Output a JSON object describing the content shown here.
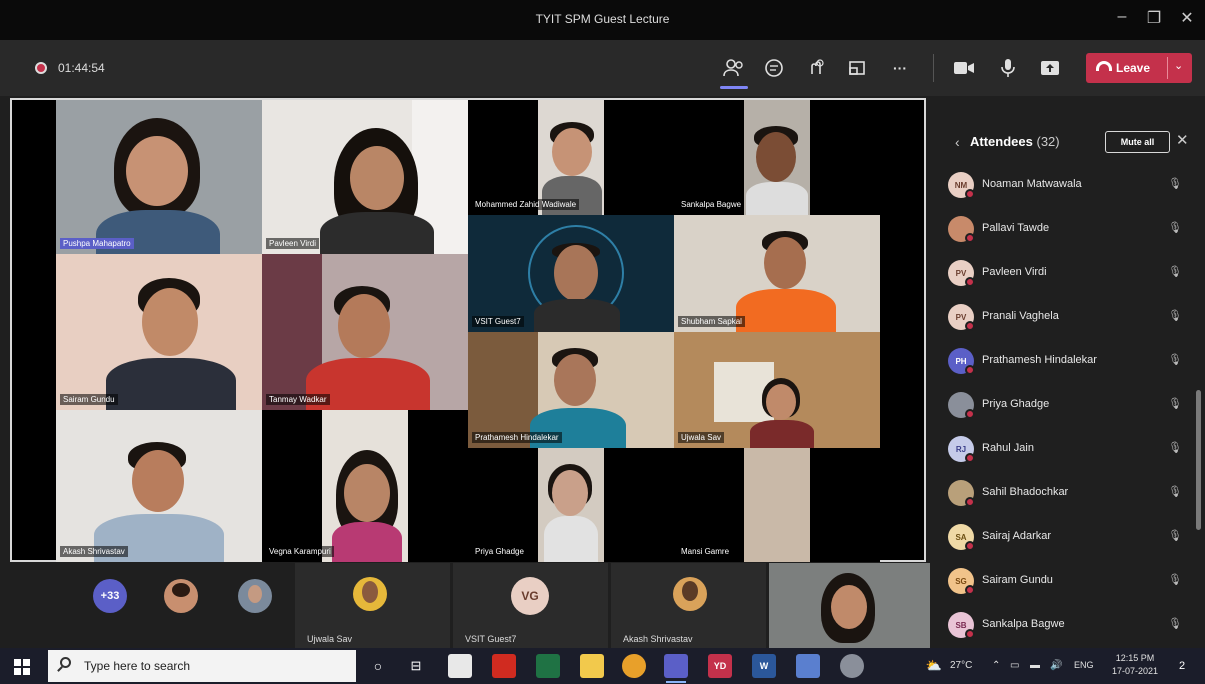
{
  "window": {
    "title": "TYIT SPM Guest Lecture",
    "minimize": "–",
    "maximize": "❐",
    "close": "✕"
  },
  "toolbar": {
    "timer": "01:44:54",
    "icons": [
      "people-icon",
      "chat-icon",
      "reactions-icon",
      "rooms-icon",
      "more-icon",
      "camera-icon",
      "mic-icon",
      "share-icon"
    ],
    "more_glyph": "···",
    "leave_label": "Leave",
    "leave_chevron": "⌄",
    "accent": "#c4314b"
  },
  "video": {
    "tiles": [
      {
        "name": "Pushpa Mahapatro",
        "highlighted": true
      },
      {
        "name": "Pavleen Virdi"
      },
      {
        "name": "Mohammed Zahid Wadiwale"
      },
      {
        "name": "Sankalpa Bagwe"
      },
      {
        "name": "Sairam Gundu"
      },
      {
        "name": "Tanmay Wadkar"
      },
      {
        "name": "VSIT Guest7"
      },
      {
        "name": "Shubham Sapkal"
      },
      {
        "name": "Prathamesh Hindalekar"
      },
      {
        "name": "Ujwala Sav"
      },
      {
        "name": "Akash Shrivastav"
      },
      {
        "name": "Vegna Karampuri"
      },
      {
        "name": "Priya Ghadge"
      },
      {
        "name": "Mansi Gamre"
      }
    ]
  },
  "strip": {
    "more_count": "+33",
    "slots": [
      {
        "label": "Ujwala Sav"
      },
      {
        "label": "VSIT Guest7",
        "initials": "VG"
      },
      {
        "label": "Akash Shrivastav"
      }
    ]
  },
  "panel": {
    "title": "Attendees",
    "count": "(32)",
    "back": "‹",
    "mute_all": "Mute all",
    "close": "✕",
    "attendees": [
      {
        "name": "Noaman Matwawala",
        "initials": "NM"
      },
      {
        "name": "Pallavi Tawde",
        "initials": ""
      },
      {
        "name": "Pavleen Virdi",
        "initials": "PV"
      },
      {
        "name": "Pranali Vaghela",
        "initials": "PV"
      },
      {
        "name": "Prathamesh Hindalekar",
        "initials": "PH"
      },
      {
        "name": "Priya Ghadge",
        "initials": ""
      },
      {
        "name": "Rahul Jain",
        "initials": "RJ"
      },
      {
        "name": "Sahil Bhadochkar",
        "initials": ""
      },
      {
        "name": "Sairaj Adarkar",
        "initials": "SA"
      },
      {
        "name": "Sairam Gundu",
        "initials": "SG"
      },
      {
        "name": "Sankalpa Bagwe",
        "initials": "SB"
      }
    ],
    "mic_glyph": "🎙"
  },
  "taskbar": {
    "search_placeholder": "Type here to search",
    "weather": "27°C",
    "lang": "ENG",
    "time": "12:15 PM",
    "date": "17-07-2021",
    "notif_count": "2",
    "apps": [
      {
        "label": "YD",
        "color": "#c4314b"
      },
      {
        "label": "W",
        "color": "#2b579a"
      }
    ]
  }
}
